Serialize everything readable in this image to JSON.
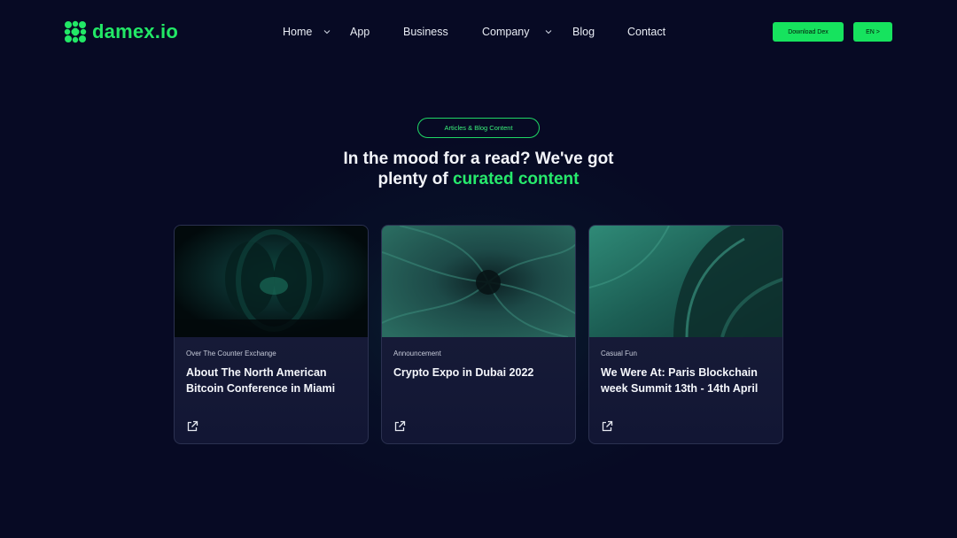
{
  "brand": {
    "name": "damex.io",
    "color": "#22e866"
  },
  "nav": {
    "home": "Home",
    "app": "App",
    "business": "Business",
    "company": "Company",
    "blog": "Blog",
    "contact": "Contact"
  },
  "actions": {
    "download": "Download Dex",
    "language": "EN >"
  },
  "hero": {
    "badge": "Articles & Blog Content",
    "headline_line1": "In the mood for a read? We've got",
    "headline_plain": "plenty of ",
    "headline_accent": "curated content"
  },
  "cards": [
    {
      "category": "Over The Counter Exchange",
      "title": "About The North American Bitcoin Conference in Miami",
      "icon": "external-link-icon"
    },
    {
      "category": "Announcement",
      "title": "Crypto Expo in Dubai 2022",
      "icon": "external-link-icon"
    },
    {
      "category": "Casual Fun",
      "title": "We Were At: Paris Blockchain week Summit 13th - 14th April",
      "icon": "external-link-icon"
    }
  ],
  "colors": {
    "background": "#070a24",
    "accent": "#16e35e",
    "card": "#161a36"
  }
}
